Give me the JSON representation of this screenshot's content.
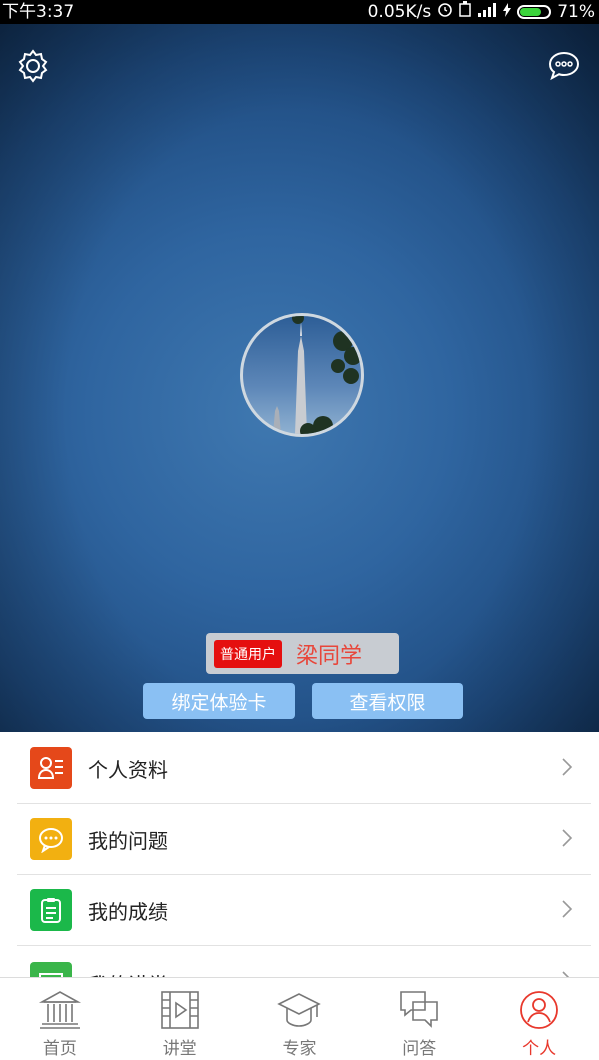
{
  "status_bar": {
    "time": "下午3:37",
    "network_speed": "0.05K/s",
    "battery": "71%"
  },
  "profile": {
    "user_type_badge": "普通用户",
    "username": "梁同学",
    "bind_card_button": "绑定体验卡",
    "view_permissions_button": "查看权限"
  },
  "menu": {
    "items": [
      {
        "label": "个人资料",
        "icon": "profile-card-icon",
        "color": "#e5481a"
      },
      {
        "label": "我的问题",
        "icon": "chat-bubble-icon",
        "color": "#f2b011"
      },
      {
        "label": "我的成绩",
        "icon": "clipboard-icon",
        "color": "#1bb84a"
      },
      {
        "label": "我的讲堂",
        "icon": "lecture-icon",
        "color": "#3ab54a"
      }
    ]
  },
  "bottom_nav": {
    "items": [
      {
        "label": "首页",
        "icon": "home-building-icon"
      },
      {
        "label": "讲堂",
        "icon": "video-film-icon"
      },
      {
        "label": "专家",
        "icon": "graduation-cap-icon"
      },
      {
        "label": "问答",
        "icon": "qa-bubbles-icon"
      },
      {
        "label": "个人",
        "icon": "person-icon"
      }
    ],
    "active_color": "#e8382c"
  }
}
